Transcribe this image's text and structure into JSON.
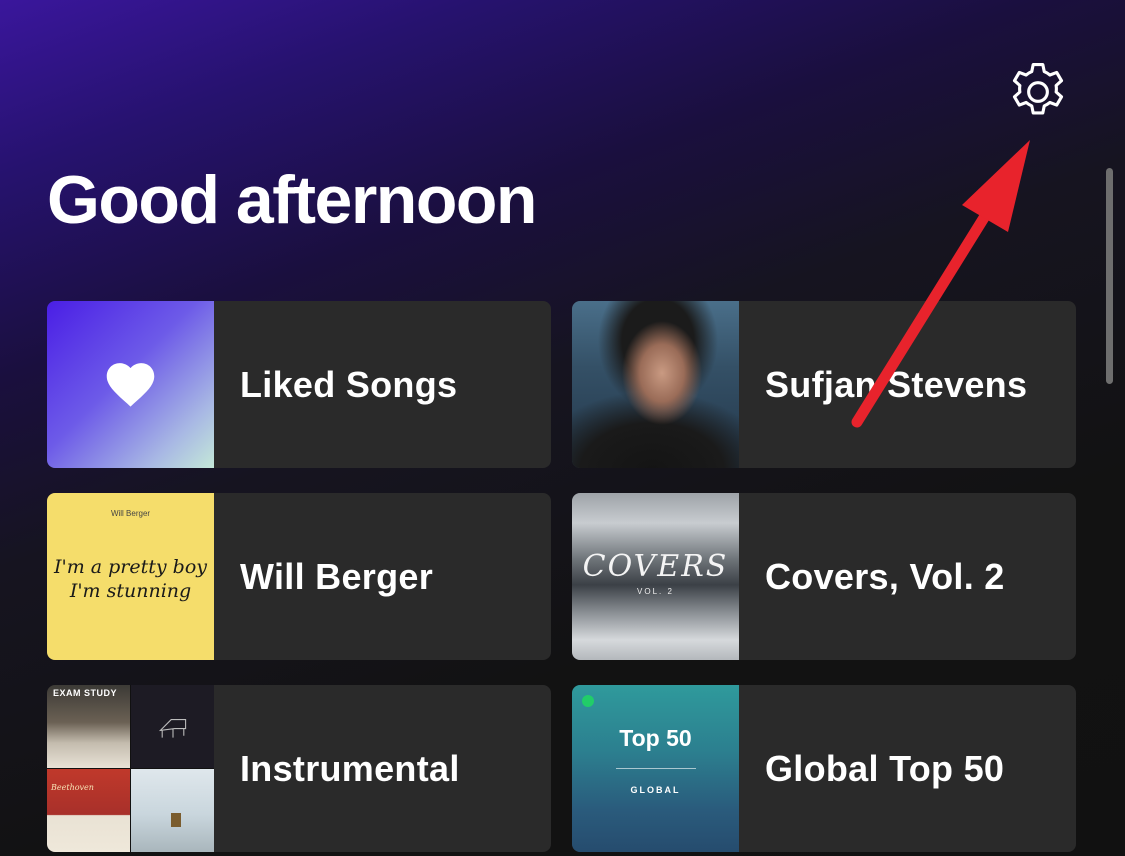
{
  "header": {
    "greeting": "Good afternoon",
    "settings_icon": "gear-icon"
  },
  "cards": [
    {
      "title": "Liked Songs",
      "art_icon": "heart-icon"
    },
    {
      "title": "Sufjan Stevens"
    },
    {
      "title": "Will Berger",
      "art_text_top": "Will Berger",
      "art_text_line1": "I'm a pretty boy",
      "art_text_line2": "I'm stunning"
    },
    {
      "title": "Covers, Vol. 2",
      "art_text_main": "COVERS",
      "art_text_sub": "VOL. 2"
    },
    {
      "title": "Instrumental",
      "art_tile1_text": "EXAM STUDY",
      "art_tile3_text": "Beethoven"
    },
    {
      "title": "Global Top 50",
      "art_text_main": "Top 50",
      "art_text_sub": "GLOBAL"
    }
  ],
  "annotation": {
    "arrow_color": "#e8232c",
    "points_to": "gear-icon"
  },
  "colors": {
    "card_background": "#2a2a2a",
    "header_gradient_top": "#3a169c",
    "page_background": "#121212"
  }
}
